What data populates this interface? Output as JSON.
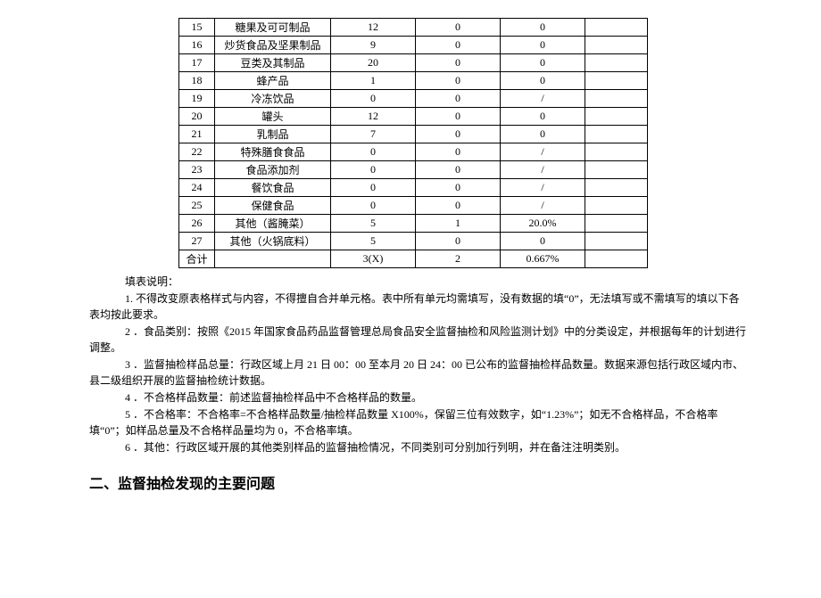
{
  "chart_data": {
    "type": "table",
    "rows": [
      {
        "idx": "15",
        "cat": "糖果及可可制品",
        "a": "12",
        "b": "0",
        "c": "0",
        "d": ""
      },
      {
        "idx": "16",
        "cat": "炒货食品及坚果制品",
        "a": "9",
        "b": "0",
        "c": "0",
        "d": ""
      },
      {
        "idx": "17",
        "cat": "豆类及其制品",
        "a": "20",
        "b": "0",
        "c": "0",
        "d": ""
      },
      {
        "idx": "18",
        "cat": "蜂产品",
        "a": "1",
        "b": "0",
        "c": "0",
        "d": ""
      },
      {
        "idx": "19",
        "cat": "冷冻饮品",
        "a": "0",
        "b": "0",
        "c": "/",
        "d": ""
      },
      {
        "idx": "20",
        "cat": "罐头",
        "a": "12",
        "b": "0",
        "c": "0",
        "d": ""
      },
      {
        "idx": "21",
        "cat": "乳制品",
        "a": "7",
        "b": "0",
        "c": "0",
        "d": ""
      },
      {
        "idx": "22",
        "cat": "特殊膳食食品",
        "a": "0",
        "b": "0",
        "c": "/",
        "d": ""
      },
      {
        "idx": "23",
        "cat": "食品添加剂",
        "a": "0",
        "b": "0",
        "c": "/",
        "d": ""
      },
      {
        "idx": "24",
        "cat": "餐饮食品",
        "a": "0",
        "b": "0",
        "c": "/",
        "d": ""
      },
      {
        "idx": "25",
        "cat": "保健食品",
        "a": "0",
        "b": "0",
        "c": "/",
        "d": ""
      },
      {
        "idx": "26",
        "cat": "其他（酱腌菜）",
        "a": "5",
        "b": "1",
        "c": "20.0%",
        "d": ""
      },
      {
        "idx": "27",
        "cat": "其他（火锅底料）",
        "a": "5",
        "b": "0",
        "c": "0",
        "d": ""
      },
      {
        "idx": "合计",
        "cat": "",
        "a": "3(X)",
        "b": "2",
        "c": "0.667%",
        "d": ""
      }
    ]
  },
  "notes": {
    "title": "填表说明：",
    "n1": "1. 不得改变原表格样式与内容，不得擅自合并单元格。表中所有单元均需填写，没有数据的填“0”，无法填写或不需填写的填以下各表均按此要求。",
    "n2": "2 ．食品类别：按照《2015 年国家食品药品监督管理总局食品安全监督抽检和风险监测计划》中的分类设定，并根据每年的计划进行调整。",
    "n3": "3 ．监督抽检样品总量：行政区域上月 21 日 00：00 至本月 20 日 24：00 已公布的监督抽检样品数量。数据来源包括行政区域内市、县二级组织开展的监督抽检统计数据。",
    "n4": "4  ．不合格样品数量：前述监督抽检样品中不合格样品的数量。",
    "n5": "5 ．不合格率：不合格率=不合格样品数量/抽检样品数量 X100%，保留三位有效数字，如“1.23%”；如无不合格样品，不合格率填“0”；如样品总量及不合格样品量均为 0，不合格率填。",
    "n6": "6  ．其他：行政区域开展的其他类别样品的监督抽检情况，不同类别可分别加行列明，并在备注注明类别。"
  },
  "heading2": "二、监督抽检发现的主要问题"
}
